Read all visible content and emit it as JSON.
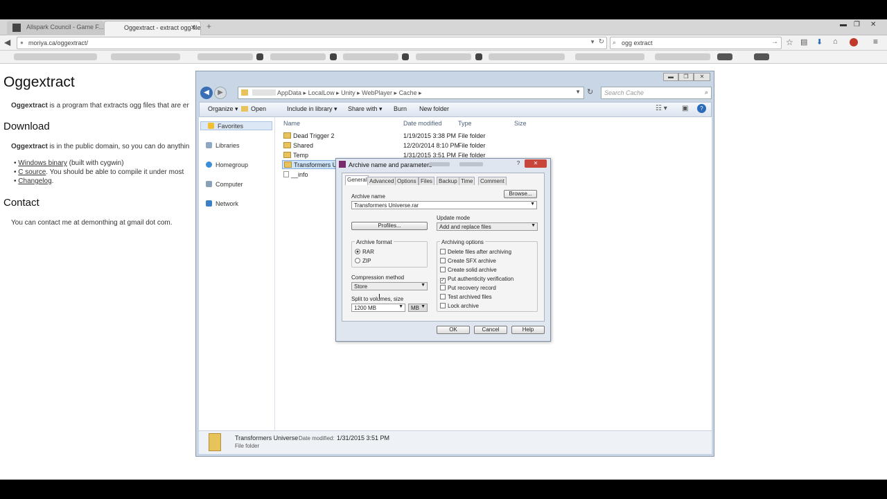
{
  "browser": {
    "tabs": [
      {
        "label": "Allspark Council - Game F...",
        "active": false
      },
      {
        "label": "Oggextract - extract ogg files fr...",
        "active": true
      }
    ],
    "url": "moriya.ca/oggextract/",
    "search_value": "ogg extract"
  },
  "page": {
    "title": "Oggextract",
    "intro_strong": "Oggextract",
    "intro_text": " is a program that extracts ogg files that are er",
    "download_heading": "Download",
    "download_strong": "Oggextract",
    "download_text": " is in the public domain, so you can do anythin",
    "links": [
      {
        "link": "Windows binary",
        "text": " (built with cygwin)"
      },
      {
        "link": "C source",
        "text": ". You should be able to compile it under most"
      },
      {
        "link": "Changelog",
        "text": "."
      }
    ],
    "contact_heading": "Contact",
    "contact_text": "You can contact me at demonthing at gmail dot com."
  },
  "explorer": {
    "breadcrumb": [
      "AppData",
      "LocalLow",
      "Unity",
      "WebPlayer",
      "Cache"
    ],
    "search_placeholder": "Search Cache",
    "toolbar": [
      "Organize",
      "Open",
      "Include in library",
      "Share with",
      "Burn",
      "New folder"
    ],
    "nav": [
      "Favorites",
      "Libraries",
      "Homegroup",
      "Computer",
      "Network"
    ],
    "columns": [
      "Name",
      "Date modified",
      "Type",
      "Size"
    ],
    "rows": [
      {
        "name": "Dead Trigger 2",
        "date": "1/19/2015 3:38 PM",
        "type": "File folder"
      },
      {
        "name": "Shared",
        "date": "12/20/2014 8:10 PM",
        "type": "File folder"
      },
      {
        "name": "Temp",
        "date": "1/31/2015 3:51 PM",
        "type": "File folder"
      },
      {
        "name": "Transformers Unive",
        "date": "",
        "type": ""
      },
      {
        "name": "__info",
        "date": "",
        "type": ""
      }
    ],
    "status": {
      "name": "Transformers Universe",
      "date_label": "Date modified:",
      "date": "1/31/2015 3:51 PM",
      "type": "File folder"
    }
  },
  "dialog": {
    "title": "Archive name and parameters",
    "tabs": [
      "General",
      "Advanced",
      "Options",
      "Files",
      "Backup",
      "Time",
      "Comment"
    ],
    "archive_name_label": "Archive name",
    "archive_name": "Transformers Universe.rar",
    "browse": "Browse...",
    "profiles": "Profiles...",
    "update_mode_label": "Update mode",
    "update_mode": "Add and replace files",
    "archive_format_label": "Archive format",
    "formats": [
      "RAR",
      "ZIP"
    ],
    "compression_label": "Compression method",
    "compression": "Store",
    "split_label": "Split to volumes, size",
    "split_value": "1200 MB",
    "split_unit": "MB",
    "options_label": "Archiving options",
    "options": [
      {
        "label": "Delete files after archiving",
        "checked": false
      },
      {
        "label": "Create SFX archive",
        "checked": false
      },
      {
        "label": "Create solid archive",
        "checked": false
      },
      {
        "label": "Put authenticity verification",
        "checked": true
      },
      {
        "label": "Put recovery record",
        "checked": false
      },
      {
        "label": "Test archived files",
        "checked": false
      },
      {
        "label": "Lock archive",
        "checked": false
      }
    ],
    "ok": "OK",
    "cancel": "Cancel",
    "help": "Help"
  }
}
